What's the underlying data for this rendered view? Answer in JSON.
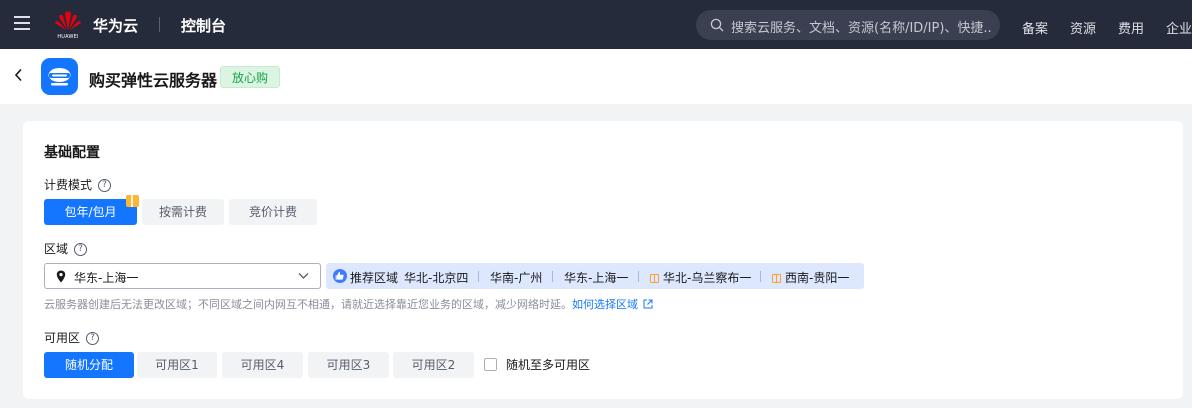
{
  "topbar": {
    "logo_text": "HUAWEI",
    "brand": "华为云",
    "console": "控制台",
    "search_placeholder": "搜索云服务、文档、资源(名称/ID/IP)、快捷...",
    "nav": [
      "备案",
      "资源",
      "费用",
      "企业"
    ]
  },
  "header": {
    "title": "购买弹性云服务器",
    "badge": "放心购"
  },
  "config": {
    "section_title": "基础配置",
    "billing": {
      "label": "计费模式",
      "options": [
        "包年/包月",
        "按需计费",
        "竞价计费"
      ],
      "selected": "包年/包月"
    },
    "region": {
      "label": "区域",
      "selected": "华东-上海一",
      "recommend_label": "推荐区域",
      "recommended": [
        "华北-北京四",
        "华南-广州",
        "华东-上海一",
        "华北-乌兰察布一",
        "西南-贵阳一"
      ],
      "hint": "云服务器创建后无法更改区域；不同区域之间内网互不相通，请就近选择靠近您业务的区域，减少网络时延。",
      "hint_link": "如何选择区域"
    },
    "az": {
      "label": "可用区",
      "options": [
        "随机分配",
        "可用区1",
        "可用区4",
        "可用区3",
        "可用区2"
      ],
      "selected": "随机分配",
      "multi_az_label": "随机至多可用区"
    }
  },
  "colors": {
    "topbar_bg": "#252b3a",
    "accent": "#1476ff",
    "badge_bg": "#dcf4e2",
    "badge_text": "#16a34a"
  }
}
